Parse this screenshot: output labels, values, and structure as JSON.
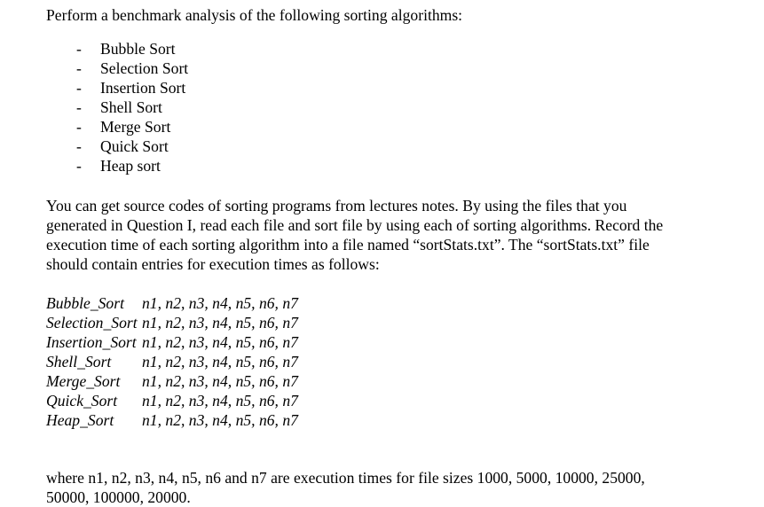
{
  "title": "Perform a benchmark analysis of the following sorting algorithms:",
  "algorithms": {
    "bullet": "-",
    "items": [
      "Bubble Sort",
      "Selection Sort",
      "Insertion Sort",
      "Shell Sort",
      "Merge Sort",
      "Quick Sort",
      "Heap sort"
    ]
  },
  "instructions": {
    "lines": [
      "You can get source codes of sorting programs from lectures notes. By using the files that you",
      "generated in Question I, read each file and sort file by using each of sorting algorithms. Record the",
      "execution time of each sorting algorithm into a file named “sortStats.txt”. The “sortStats.txt” file",
      "should contain entries for execution times as follows:"
    ]
  },
  "format": {
    "rows": [
      {
        "label": "Bubble_Sort",
        "values": "n1, n2, n3, n4, n5, n6, n7"
      },
      {
        "label": "Selection_Sort",
        "values": "n1, n2, n3, n4, n5, n6, n7"
      },
      {
        "label": "Insertion_Sort",
        "values": "n1, n2, n3, n4, n5, n6, n7"
      },
      {
        "label": "Shell_Sort",
        "values": "n1, n2, n3, n4, n5, n6, n7"
      },
      {
        "label": "Merge_Sort",
        "values": "n1, n2, n3, n4, n5, n6, n7"
      },
      {
        "label": "Quick_Sort",
        "values": "n1, n2, n3, n4, n5, n6, n7"
      },
      {
        "label": "Heap_Sort",
        "values": "n1, n2, n3, n4, n5, n6, n7"
      }
    ]
  },
  "footer": {
    "lines": [
      "where n1, n2, n3, n4, n5, n6 and n7 are execution times for file sizes 1000, 5000, 10000, 25000,",
      "50000, 100000, 20000."
    ]
  }
}
